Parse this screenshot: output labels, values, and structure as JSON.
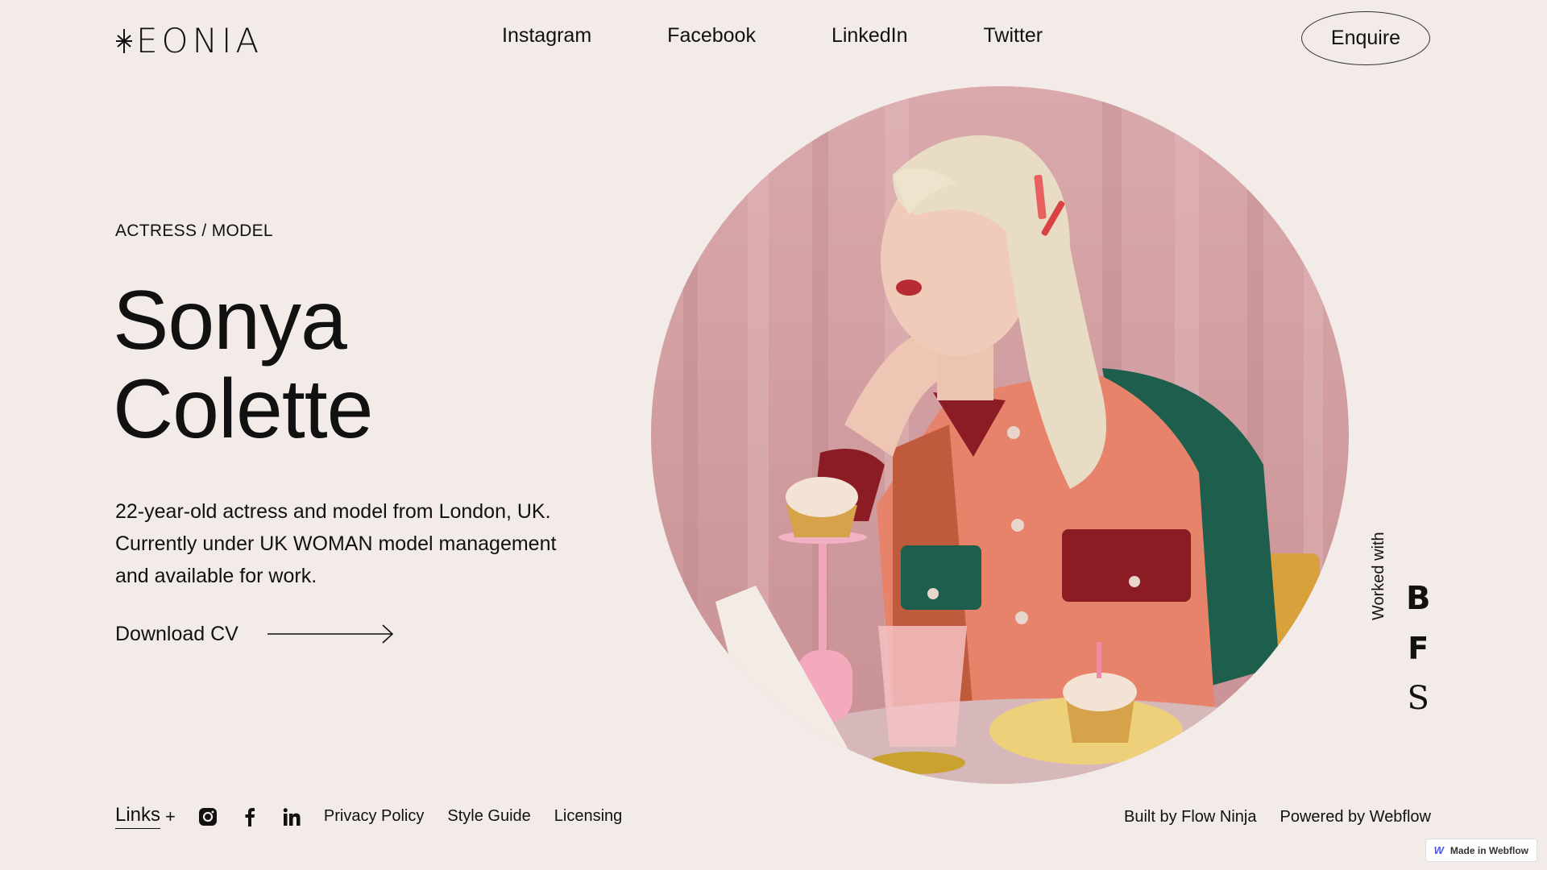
{
  "header": {
    "logo_text": "EONIA",
    "nav": [
      "Instagram",
      "Facebook",
      "LinkedIn",
      "Twitter"
    ],
    "enquire_label": "Enquire"
  },
  "hero": {
    "eyebrow": "ACTRESS / MODEL",
    "name_line1": "Sonya",
    "name_line2": "Colette",
    "bio": "22-year-old actress and model  from London, UK. Currently under UK WOMAN model management and available for work.",
    "cv_label": "Download CV"
  },
  "worked_with": {
    "label": "Worked with",
    "brands": [
      "B",
      "F",
      "S"
    ]
  },
  "footer": {
    "links_label": "Links",
    "plus": "+",
    "social_icons": [
      "instagram-icon",
      "facebook-icon",
      "linkedin-icon"
    ],
    "links": [
      "Privacy Policy",
      "Style Guide",
      "Licensing"
    ],
    "built_by": "Built by Flow Ninja",
    "powered_by": "Powered by Webflow"
  },
  "badge": {
    "label": "Made in Webflow"
  },
  "colors": {
    "background": "#f2ebe8",
    "text": "#111111",
    "curtain_pink": "#d9a9ac"
  }
}
